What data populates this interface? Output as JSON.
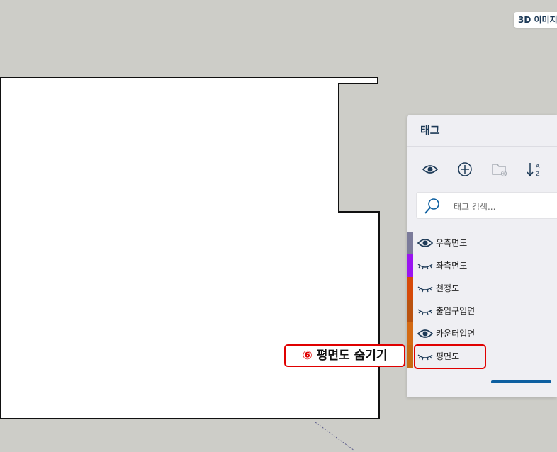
{
  "viewport": {
    "badge_label": "3D 이미지"
  },
  "tags_panel": {
    "title": "태그",
    "toolbar": {
      "visibility": "eye-icon",
      "add": "add-tag-icon",
      "folder": "add-folder-icon",
      "sort": "sort-az-icon"
    },
    "search": {
      "placeholder": "태그 검색..."
    },
    "items": [
      {
        "label": "우측면도",
        "visible": true,
        "color": "#7b7b9a"
      },
      {
        "label": "좌측면도",
        "visible": false,
        "color": "#9a14f0"
      },
      {
        "label": "천정도",
        "visible": false,
        "color": "#d64a09"
      },
      {
        "label": "출입구입면",
        "visible": false,
        "color": "#b9520f"
      },
      {
        "label": "카운터입면",
        "visible": true,
        "color": "#d36a14"
      },
      {
        "label": "평면도",
        "visible": false,
        "color": "#c66b14"
      }
    ]
  },
  "annotation": {
    "number": "⑥",
    "text": "평면도 숨기기"
  },
  "colors": {
    "accent": "#0d5fa0",
    "annotation": "#e00000",
    "background": "#cdcdc8"
  }
}
